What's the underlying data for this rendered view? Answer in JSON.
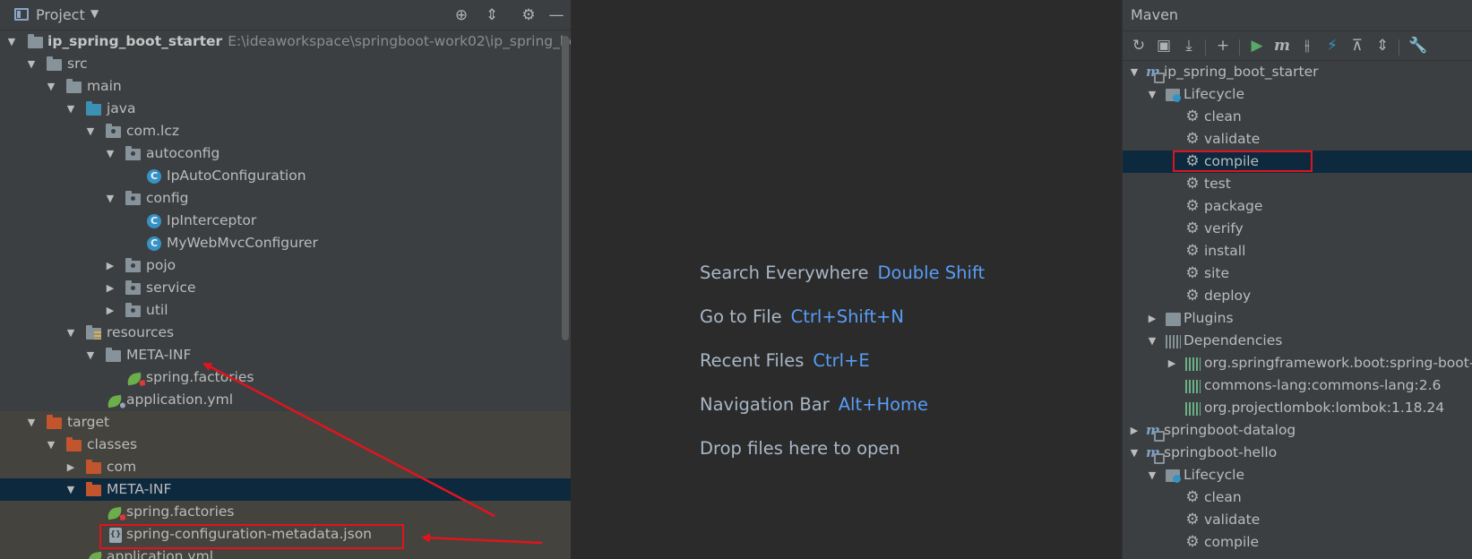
{
  "project_panel": {
    "title": "Project",
    "root_name": "ip_spring_boot_starter",
    "root_path": "E:\\ideaworkspace\\springboot-work02\\ip_spring_boot_st",
    "items": [
      {
        "label": "src"
      },
      {
        "label": "main"
      },
      {
        "label": "java"
      },
      {
        "label": "com.lcz"
      },
      {
        "label": "autoconfig"
      },
      {
        "label": "IpAutoConfiguration"
      },
      {
        "label": "config"
      },
      {
        "label": "IpInterceptor"
      },
      {
        "label": "MyWebMvcConfigurer"
      },
      {
        "label": "pojo"
      },
      {
        "label": "service"
      },
      {
        "label": "util"
      },
      {
        "label": "resources"
      },
      {
        "label": "META-INF"
      },
      {
        "label": "spring.factories"
      },
      {
        "label": "application.yml"
      },
      {
        "label": "target"
      },
      {
        "label": "classes"
      },
      {
        "label": "com"
      },
      {
        "label": "META-INF"
      },
      {
        "label": "spring.factories"
      },
      {
        "label": "spring-configuration-metadata.json"
      },
      {
        "label": "application.yml"
      }
    ]
  },
  "editor": {
    "hints": [
      {
        "text": "Search Everywhere",
        "key": "Double Shift"
      },
      {
        "text": "Go to File",
        "key": "Ctrl+Shift+N"
      },
      {
        "text": "Recent Files",
        "key": "Ctrl+E"
      },
      {
        "text": "Navigation Bar",
        "key": "Alt+Home"
      },
      {
        "text": "Drop files here to open",
        "key": ""
      }
    ]
  },
  "maven_panel": {
    "title": "Maven",
    "items": [
      {
        "label": "ip_spring_boot_starter"
      },
      {
        "label": "Lifecycle"
      },
      {
        "label": "clean"
      },
      {
        "label": "validate"
      },
      {
        "label": "compile"
      },
      {
        "label": "test"
      },
      {
        "label": "package"
      },
      {
        "label": "verify"
      },
      {
        "label": "install"
      },
      {
        "label": "site"
      },
      {
        "label": "deploy"
      },
      {
        "label": "Plugins"
      },
      {
        "label": "Dependencies"
      },
      {
        "label": "org.springframework.boot:spring-boot-"
      },
      {
        "label": "commons-lang:commons-lang:2.6"
      },
      {
        "label": "org.projectlombok:lombok:1.18.24"
      },
      {
        "label": "springboot-datalog"
      },
      {
        "label": "springboot-hello"
      },
      {
        "label": "Lifecycle"
      },
      {
        "label": "clean"
      },
      {
        "label": "validate"
      },
      {
        "label": "compile"
      }
    ]
  },
  "annotation_color": "#e0141e"
}
